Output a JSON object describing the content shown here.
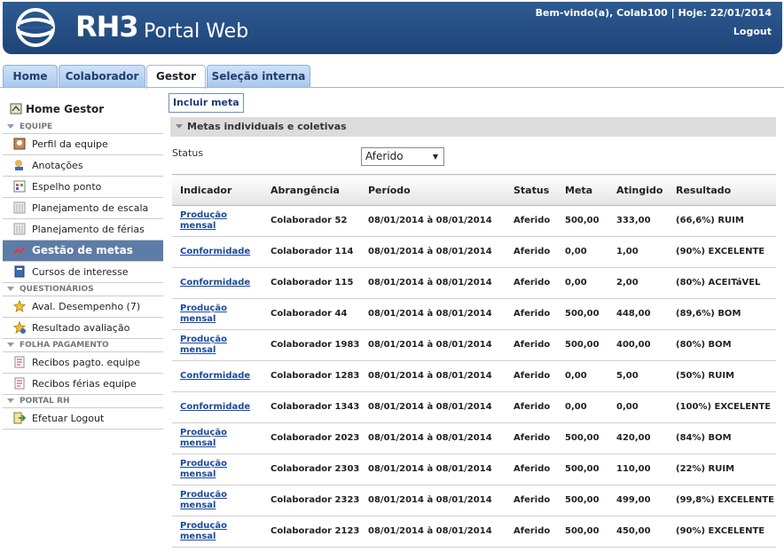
{
  "header": {
    "logo_text": "RH3",
    "logo_subtitle": "Portal Web",
    "welcome": "Bem-vindo(a), Colab100 | Hoje: 22/01/2014",
    "logout": "Logout"
  },
  "tabs": [
    {
      "label": "Home"
    },
    {
      "label": "Colaborador"
    },
    {
      "label": "Gestor",
      "active": true
    },
    {
      "label": "Seleção interna"
    }
  ],
  "sidebar": {
    "home": "Home Gestor",
    "sections": [
      {
        "title": "EQUIPE",
        "items": [
          {
            "label": "Perfil da equipe",
            "icon": "profile-icon"
          },
          {
            "label": "Anotações",
            "icon": "notes-icon"
          },
          {
            "label": "Espelho ponto",
            "icon": "timesheet-icon"
          },
          {
            "label": "Planejamento de escala",
            "icon": "calendar-icon"
          },
          {
            "label": "Planejamento de férias",
            "icon": "vacation-icon"
          },
          {
            "label": "Gestão de metas",
            "icon": "chart-icon",
            "active": true
          },
          {
            "label": "Cursos de interesse",
            "icon": "book-icon"
          }
        ]
      },
      {
        "title": "QUESTIONÁRIOS",
        "items": [
          {
            "label": "Aval. Desempenho (7)",
            "icon": "star-icon"
          },
          {
            "label": "Resultado avaliação",
            "icon": "result-icon"
          }
        ]
      },
      {
        "title": "FOLHA PAGAMENTO",
        "items": [
          {
            "label": "Recibos pagto. equipe",
            "icon": "receipt-icon"
          },
          {
            "label": "Recibos férias equipe",
            "icon": "receipt-icon"
          }
        ]
      },
      {
        "title": "PORTAL RH",
        "items": [
          {
            "label": "Efetuar Logout",
            "icon": "logout-icon"
          }
        ]
      }
    ]
  },
  "main": {
    "include_button": "Incluir meta",
    "panel_title": "Metas individuais e coletivas",
    "status_label": "Status",
    "status_value": "Aferido",
    "columns": [
      "Indicador",
      "Abrangência",
      "Período",
      "Status",
      "Meta",
      "Atingido",
      "Resultado"
    ],
    "rows": [
      {
        "indicador": "Produção mensal",
        "abrangencia": "Colaborador 52",
        "periodo": "08/01/2014 à 08/01/2014",
        "status": "Aferido",
        "meta": "500,00",
        "atingido": "333,00",
        "resultado": "(66,6%) RUIM"
      },
      {
        "indicador": "Conformidade",
        "abrangencia": "Colaborador 114",
        "periodo": "08/01/2014 à 08/01/2014",
        "status": "Aferido",
        "meta": "0,00",
        "atingido": "1,00",
        "resultado": "(90%) EXCELENTE"
      },
      {
        "indicador": "Conformidade",
        "abrangencia": "Colaborador 115",
        "periodo": "08/01/2014 à 08/01/2014",
        "status": "Aferido",
        "meta": "0,00",
        "atingido": "2,00",
        "resultado": "(80%) ACEITáVEL"
      },
      {
        "indicador": "Produção mensal",
        "abrangencia": "Colaborador 44",
        "periodo": "08/01/2014 à 08/01/2014",
        "status": "Aferido",
        "meta": "500,00",
        "atingido": "448,00",
        "resultado": "(89,6%) BOM"
      },
      {
        "indicador": "Produção mensal",
        "abrangencia": "Colaborador 1983",
        "periodo": "08/01/2014 à 08/01/2014",
        "status": "Aferido",
        "meta": "500,00",
        "atingido": "400,00",
        "resultado": "(80%) BOM"
      },
      {
        "indicador": "Conformidade",
        "abrangencia": "Colaborador 1283",
        "periodo": "08/01/2014 à 08/01/2014",
        "status": "Aferido",
        "meta": "0,00",
        "atingido": "5,00",
        "resultado": "(50%) RUIM"
      },
      {
        "indicador": "Conformidade",
        "abrangencia": "Colaborador 1343",
        "periodo": "08/01/2014 à 08/01/2014",
        "status": "Aferido",
        "meta": "0,00",
        "atingido": "0,00",
        "resultado": "(100%) EXCELENTE"
      },
      {
        "indicador": "Produção mensal",
        "abrangencia": "Colaborador 2023",
        "periodo": "08/01/2014 à 08/01/2014",
        "status": "Aferido",
        "meta": "500,00",
        "atingido": "420,00",
        "resultado": "(84%) BOM"
      },
      {
        "indicador": "Produção mensal",
        "abrangencia": "Colaborador 2303",
        "periodo": "08/01/2014 à 08/01/2014",
        "status": "Aferido",
        "meta": "500,00",
        "atingido": "110,00",
        "resultado": "(22%) RUIM"
      },
      {
        "indicador": "Produção mensal",
        "abrangencia": "Colaborador 2323",
        "periodo": "08/01/2014 à 08/01/2014",
        "status": "Aferido",
        "meta": "500,00",
        "atingido": "499,00",
        "resultado": "(99,8%) EXCELENTE"
      },
      {
        "indicador": "Produção mensal",
        "abrangencia": "Colaborador 2123",
        "periodo": "08/01/2014 à 08/01/2014",
        "status": "Aferido",
        "meta": "500,00",
        "atingido": "450,00",
        "resultado": "(90%) EXCELENTE"
      }
    ]
  }
}
